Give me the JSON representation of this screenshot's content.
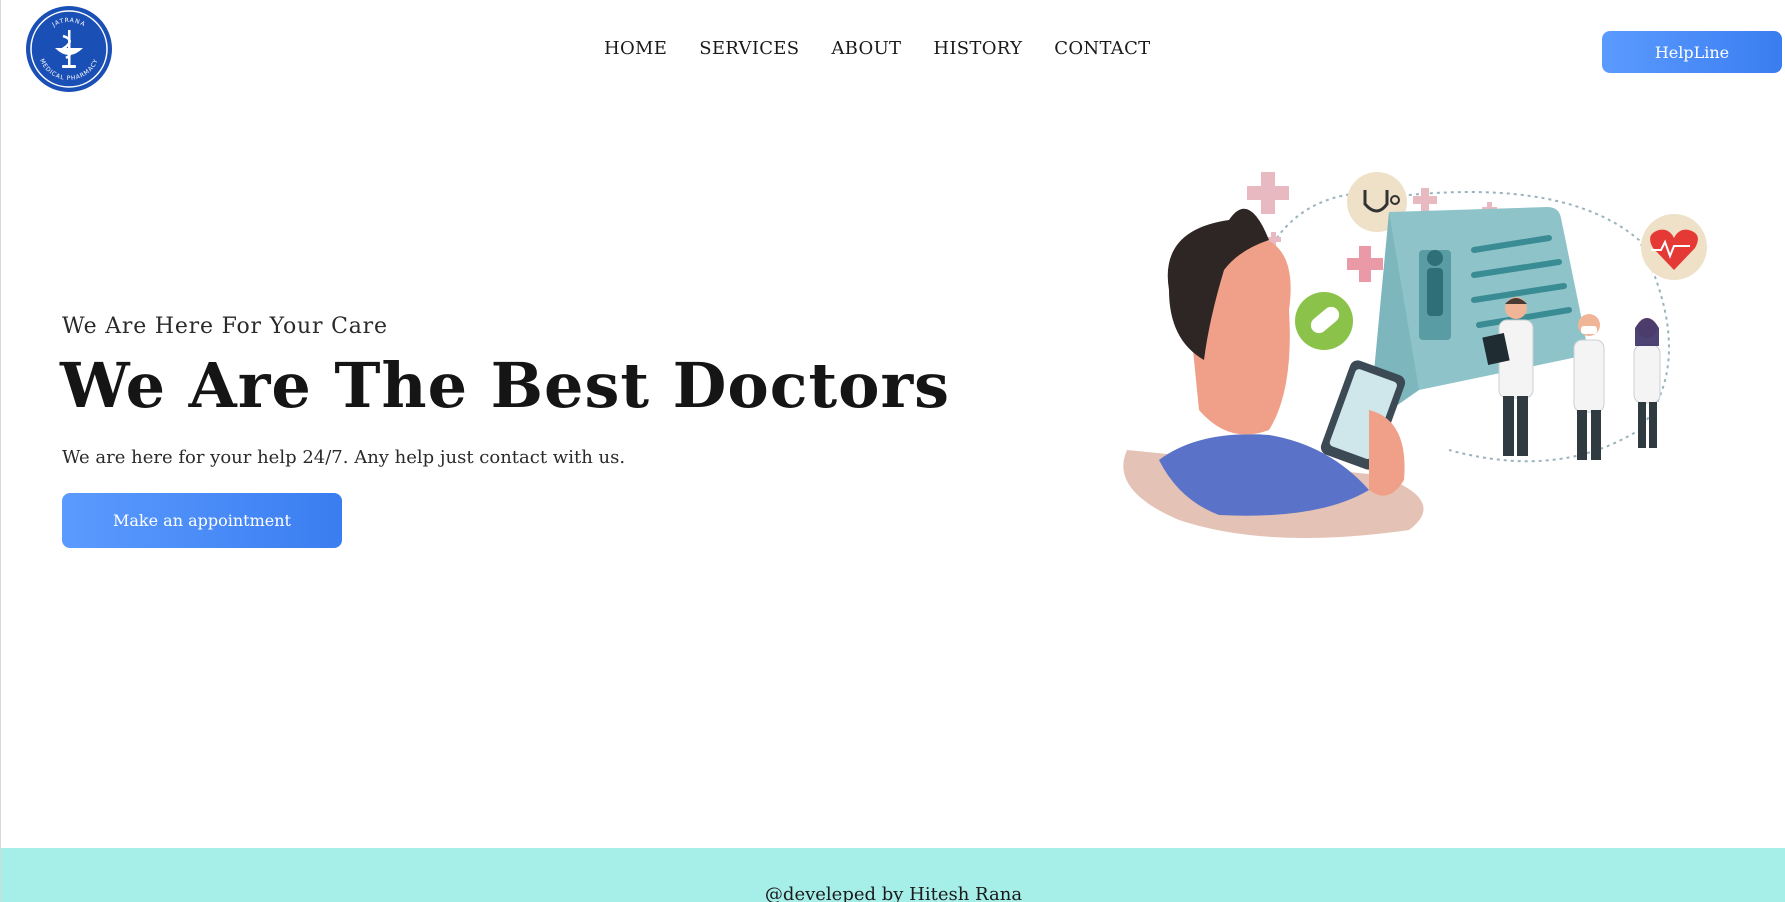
{
  "logo": {
    "ring_text_top": "JATRANA",
    "ring_text_bottom": "MEDICAL PHARMACY",
    "icon": "caduceus-bowl-icon",
    "color": "#1a4fb5"
  },
  "nav": {
    "items": [
      {
        "label": "HOME"
      },
      {
        "label": "SERVICES"
      },
      {
        "label": "ABOUT"
      },
      {
        "label": "HISTORY"
      },
      {
        "label": "CONTACT"
      }
    ]
  },
  "header": {
    "helpline_label": "HelpLine"
  },
  "hero": {
    "subtitle": "We Are Here For Your Care",
    "title": "We Are The Best Doctors",
    "text": "We are here for your help 24/7. Any help just contact with us.",
    "cta_label": "Make an appointment"
  },
  "illustration": {
    "icon": "telemedicine-illustration"
  },
  "footer": {
    "text": "@develeped by Hitesh Rana"
  },
  "colors": {
    "accent": "#4a8cff",
    "footer_bg": "#a6eee8",
    "logo_blue": "#1a4fb5"
  }
}
